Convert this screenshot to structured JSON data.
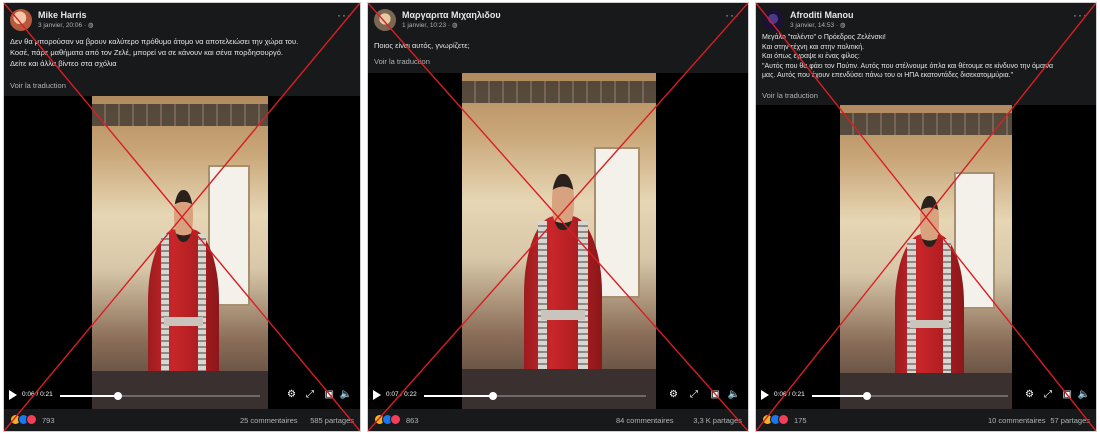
{
  "posts": [
    {
      "author": "Mike Harris",
      "date": "3 janvier, 20:06 · ",
      "text_lines": [
        "Δεν θα μπορούσαν να βρουν καλύτερο πρόθυμο άτομο να αποτελειώσει την χώρα του.",
        "Κοσέ, πάρε μαθήματα από τον Ζελέ, μπορεί να σε κάνουν και σένα πορδησουργό.",
        "Δείτε και άλλα βίντεο στα σχόλια"
      ],
      "translate": "Voir la traduction",
      "video_time": "0:06 / 0:21",
      "progress": 0.29,
      "reaction_count": "793",
      "comments": "25 commentaires",
      "shares": "585 partages"
    },
    {
      "author": "Μαργαριτα Μιχαηλιδου",
      "date": "1 janvier, 10:23 · ",
      "text_lines": [
        "Ποιος είναι αυτός, γνωρίζετε;"
      ],
      "translate": "Voir la traduction",
      "video_time": "0:07 / 0:22",
      "progress": 0.31,
      "reaction_count": "863",
      "comments": "84 commentaires",
      "shares": "3,3 K partages"
    },
    {
      "author": "Afroditi Manou",
      "date": "3 janvier, 14:53 · ",
      "text_lines": [
        "Μεγάλο \"ταλέντο\" ο Πρόεδρος Ζελένσκι!",
        "Και στην τέχνη και στην πολιτική.",
        "Και όπως έγραψε κι ένας φίλος:",
        "\"Αυτός που θα φάει τον Πούτιν. Αυτός που στέλνουμε όπλα και θέτουμε σε κίνδυνο την όμαινα",
        "μας. Αυτός που έχουν επενδύσει πάνω του οι ΗΠΑ εκατοντάδες δισεκατομμύρια.\""
      ],
      "translate": "Voir la traduction",
      "video_time": "0:06 / 0:21",
      "progress": 0.28,
      "reaction_count": "175",
      "comments": "10 commentaires",
      "shares": "57 partages"
    }
  ],
  "icons": {
    "globe": "globe-icon",
    "more": "more-options-icon",
    "play": "play-icon",
    "settings": "gear-icon",
    "expand": "expand-icon",
    "pip": "picture-in-picture-icon",
    "volume": "volume-icon",
    "reactions": [
      "haha-reaction-icon",
      "like-reaction-icon",
      "love-reaction-icon"
    ]
  },
  "colors": {
    "cross": "#d81e24",
    "like": "#1877f2",
    "love": "#f33e58",
    "haha": "#f7b125"
  }
}
